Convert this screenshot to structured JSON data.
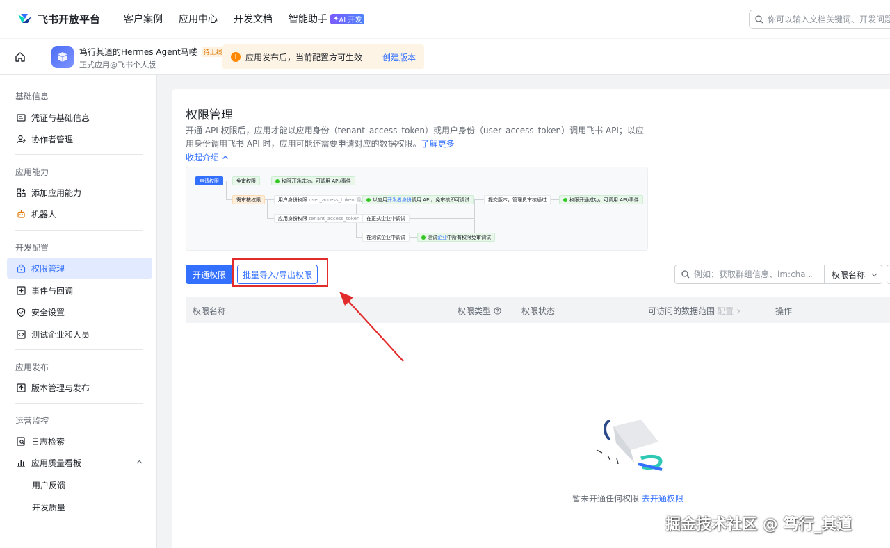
{
  "brand": {
    "name": "飞书开放平台"
  },
  "nav": {
    "links": [
      "客户案例",
      "应用中心",
      "开发文档",
      "智能助手"
    ],
    "ai_badge": "AI 开发",
    "search_placeholder": "你可以输入文档关键词、开发问题"
  },
  "app": {
    "name": "笃行其道的Hermes Agent马喽",
    "status_tag": "待上线",
    "subtitle": "正式应用@飞书个人版",
    "notice": "应用发布后，当前配置方可生效",
    "notice_link": "创建版本"
  },
  "sidebar": {
    "groups": [
      "基础信息",
      "应用能力",
      "开发配置",
      "应用发布",
      "运营监控"
    ],
    "items": {
      "credentials": "凭证与基础信息",
      "collaborators": "协作者管理",
      "add_capability": "添加应用能力",
      "bot": "机器人",
      "permissions": "权限管理",
      "events": "事件与回调",
      "security": "安全设置",
      "test_org": "测试企业和人员",
      "version": "版本管理与发布",
      "logs": "日志检索",
      "quality": "应用质量看板",
      "feedback": "用户反馈",
      "dev_quality": "开发质量"
    }
  },
  "main": {
    "title": "权限管理",
    "desc": "开通 API 权限后，应用才能以应用身份（tenant_access_token）或用户身份（user_access_token）调用飞书 API；以应用身份调用飞书 API 时，应用可能还需要申请对应的数据权限。",
    "learn_more": "了解更多",
    "collapse": "收起介绍",
    "flow": {
      "apply": "申请权限",
      "free": "免审权限",
      "free_ok": "权限开通成功，可调用 API/事件",
      "need_review": "需审核权限",
      "user_perm": "用户身份权限",
      "user_token": "user_access_token 调用",
      "dev_identity_pre": "以应用",
      "dev_identity_hl": "开发者身份",
      "dev_identity_post": "调用 API，免审核即可调试",
      "submit": "提交版本，管理员审核通过",
      "final_ok": "权限开通成功，可调用 API/事件",
      "app_perm": "应用身份权限",
      "tenant_token": "tenant_access_token 调用",
      "prod_debug": "在正式企业中调试",
      "test_debug": "在测试企业中调试",
      "test_free_pre": "测试",
      "test_free_hl": "企业",
      "test_free_post": "中所有权限免审调试"
    },
    "btn_open": "开通权限",
    "btn_import": "批量导入/导出权限",
    "search_placeholder": "例如：获取群组信息、im:cha...",
    "filter": "权限名称",
    "columns": {
      "name": "权限名称",
      "type": "权限类型",
      "status": "权限状态",
      "scope": "可访问的数据范围",
      "scope_config": "配置",
      "action": "操作"
    },
    "empty": "暂未开通任何权限",
    "empty_link": "去开通权限"
  },
  "watermark": "掘金技术社区 @ 笃行_其道",
  "colors": {
    "primary": "#3370ff",
    "highlight_red": "#e22b2b"
  }
}
